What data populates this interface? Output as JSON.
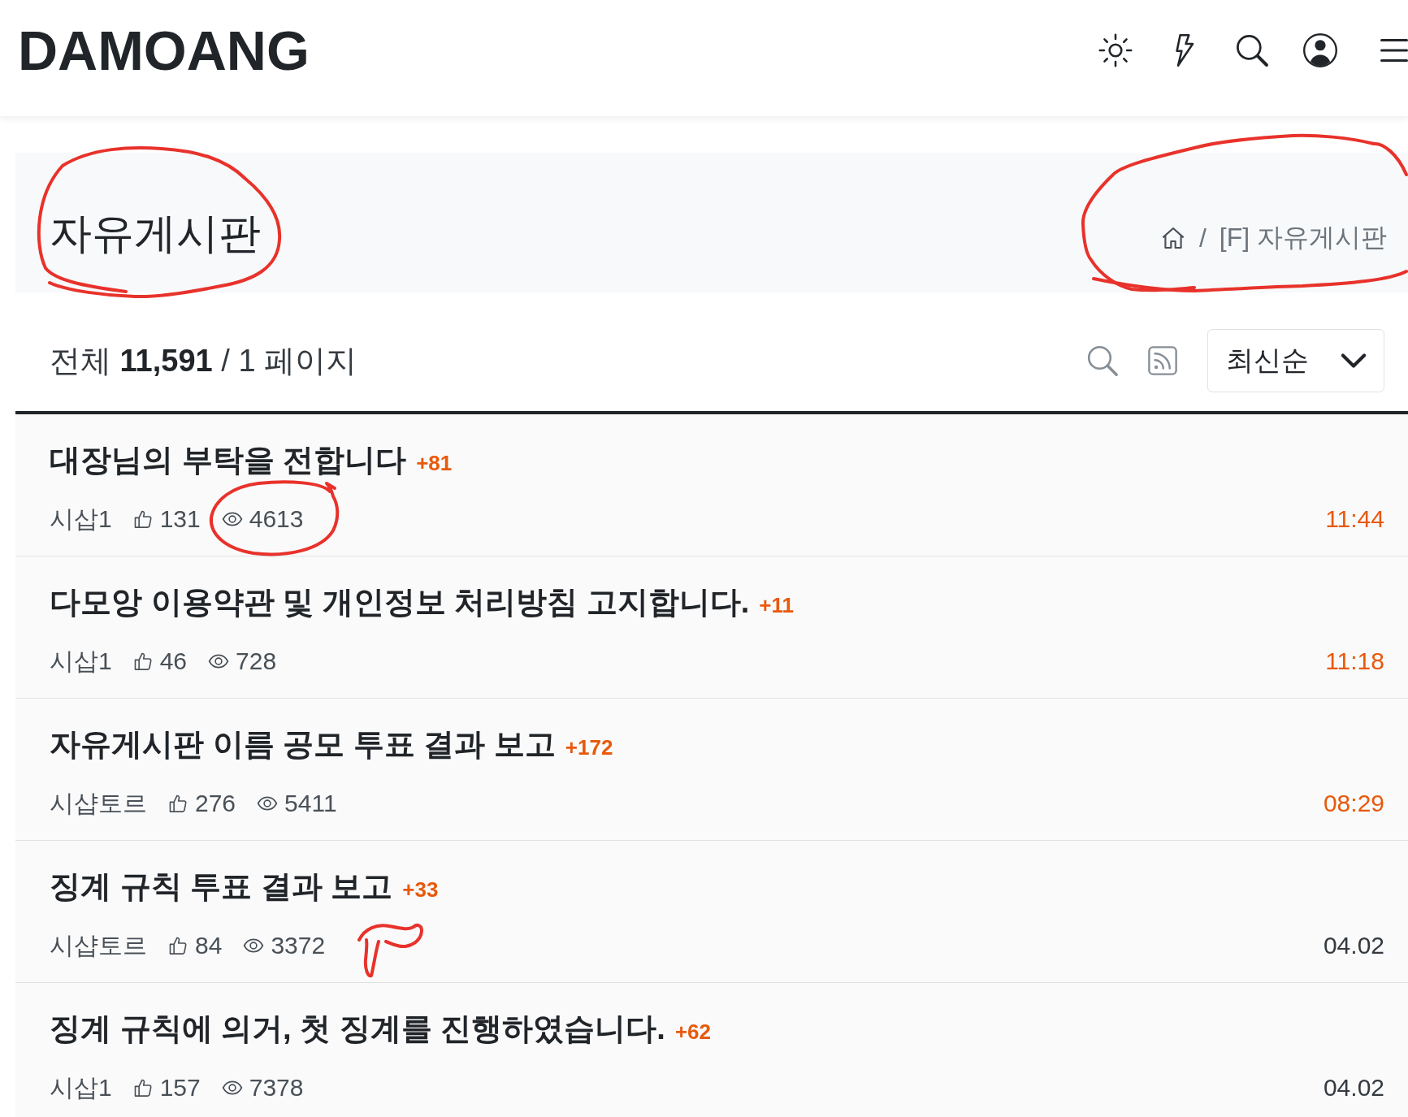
{
  "header": {
    "logo": "DAMOANG"
  },
  "page_title": {
    "text": "자유게시판",
    "circled": true
  },
  "breadcrumb": {
    "separator": "/",
    "current": "[F] 자유게시판",
    "circled": true
  },
  "toolbar": {
    "summary": "전체 **11,591** / 1 페이지",
    "sort": "최신순"
  },
  "posts": [
    {
      "title": "대장님의 부탁을 전합니다",
      "comments": "+81",
      "author": "시삽1",
      "likes": "131",
      "views": "4613",
      "time": "11:44",
      "recent": true,
      "views_circled": true,
      "views_scribble": false
    },
    {
      "title": "다모앙 이용약관 및 개인정보 처리방침 고지합니다.",
      "comments": "+11",
      "author": "시삽1",
      "likes": "46",
      "views": "728",
      "time": "11:18",
      "recent": true,
      "views_circled": false,
      "views_scribble": false
    },
    {
      "title": "자유게시판 이름 공모 투표 결과 보고",
      "comments": "+172",
      "author": "시샵토르",
      "likes": "276",
      "views": "5411",
      "time": "08:29",
      "recent": true,
      "views_circled": false,
      "views_scribble": false
    },
    {
      "title": "징계 규칙 투표 결과 보고",
      "comments": "+33",
      "author": "시샵토르",
      "likes": "84",
      "views": "3372",
      "time": "04.02",
      "recent": false,
      "views_circled": false,
      "views_scribble": true
    },
    {
      "title": "징계 규칙에 의거, 첫 징계를 진행하였습니다.",
      "comments": "+62",
      "author": "시삽1",
      "likes": "157",
      "views": "7378",
      "time": "04.02",
      "recent": false,
      "views_circled": false,
      "views_scribble": false
    }
  ]
}
